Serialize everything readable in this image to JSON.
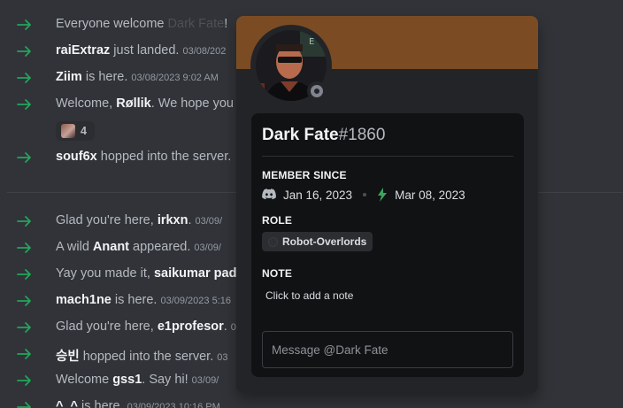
{
  "feed": {
    "messages": [
      {
        "pre": "Everyone welcome ",
        "user": "",
        "post": "",
        "ghost": "Dark Fate",
        "tail": "!",
        "ts": ""
      },
      {
        "pre": "",
        "user": "raiExtraz",
        "post": " just landed.",
        "ghost": "",
        "tail": "",
        "ts": "03/08/202"
      },
      {
        "pre": "",
        "user": "Ziim",
        "post": " is here.",
        "ghost": "",
        "tail": "",
        "ts": "03/08/2023 9:02 AM"
      },
      {
        "pre": "Welcome, ",
        "user": "Røllik",
        "post": ". We hope you",
        "ghost": "",
        "tail": "",
        "ts": ""
      },
      {
        "pre": "",
        "user": "souf6x",
        "post": " hopped into the server.",
        "ghost": "",
        "tail": "",
        "ts": ""
      },
      {
        "pre": "Glad you're here, ",
        "user": "irkxn",
        "post": ".",
        "ghost": "",
        "tail": "",
        "ts": "03/09/"
      },
      {
        "pre": "A wild ",
        "user": "Anant",
        "post": " appeared.",
        "ghost": "",
        "tail": "",
        "ts": "03/09/"
      },
      {
        "pre": "Yay you made it, ",
        "user": "saikumar pad",
        "post": "",
        "ghost": "",
        "tail": "",
        "ts": ""
      },
      {
        "pre": "",
        "user": "mach1ne",
        "post": " is here.",
        "ghost": "",
        "tail": "",
        "ts": "03/09/2023 5:16"
      },
      {
        "pre": "Glad you're here, ",
        "user": "e1profesor",
        "post": ".",
        "ghost": "",
        "tail": "",
        "ts": "0"
      },
      {
        "pre": "",
        "user": "승빈",
        "post": " hopped into the server.",
        "ghost": "",
        "tail": "",
        "ts": "03"
      },
      {
        "pre": "Welcome ",
        "user": "gss1",
        "post": ". Say hi!",
        "ghost": "",
        "tail": "",
        "ts": "03/09/"
      },
      {
        "pre": "",
        "user": "^_^",
        "post": " is here.",
        "ghost": "",
        "tail": "",
        "ts": "03/09/2023 10:16 PM"
      }
    ],
    "reaction": {
      "emoji": "avatar-emoji",
      "count": "4"
    }
  },
  "profile": {
    "username": "Dark Fate",
    "discriminator": "#1860",
    "status": "offline",
    "banner_color": "#7b4c24",
    "member_since_title": "MEMBER SINCE",
    "discord_join_date": "Jan 16, 2023",
    "server_join_date": "Mar 08, 2023",
    "role_title": "ROLE",
    "role_name": "Robot-Overlords",
    "note_title": "NOTE",
    "note_placeholder": "Click to add a note",
    "message_placeholder": "Message @Dark Fate"
  },
  "colors": {
    "arrow": "#23a55a",
    "bg": "#313338",
    "popout": "#232428",
    "card": "#111214"
  }
}
